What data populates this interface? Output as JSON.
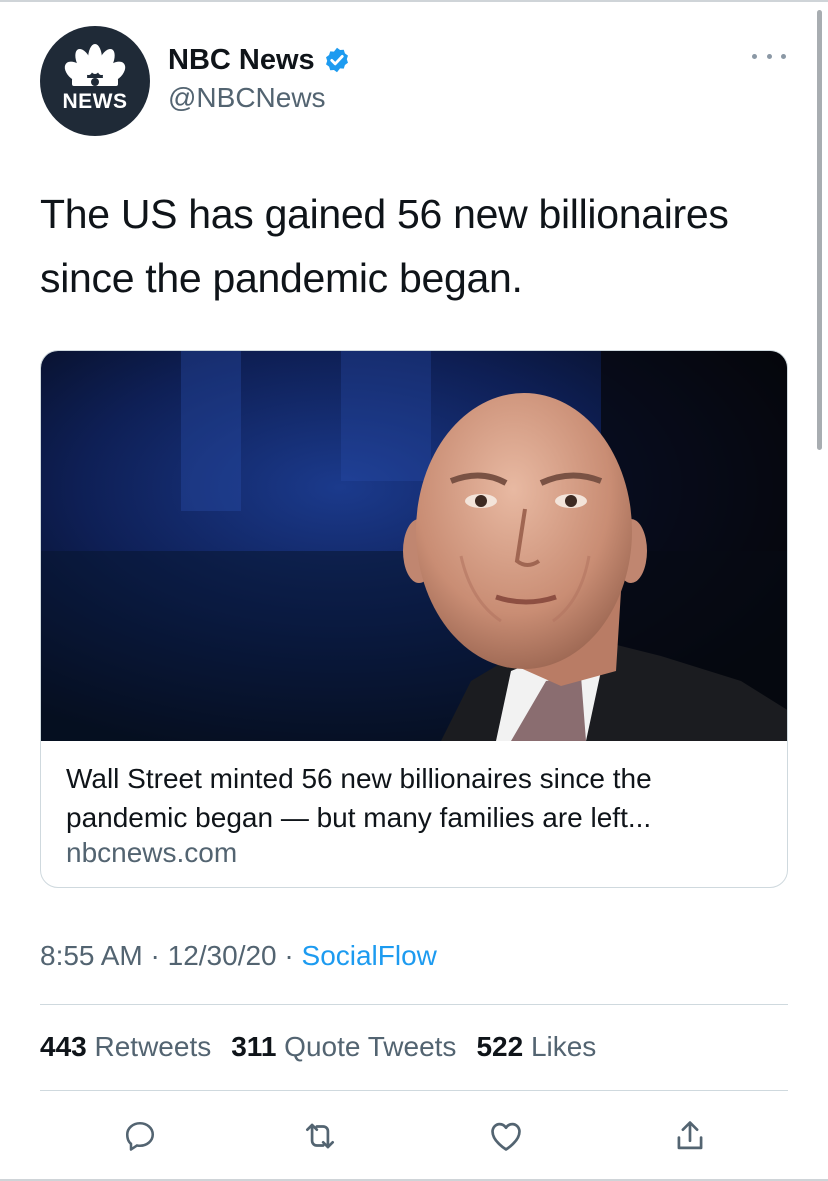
{
  "author": {
    "display_name": "NBC News",
    "handle": "@NBCNews",
    "avatar_text": "NEWS",
    "verified": true
  },
  "tweet": {
    "text": "The US has gained 56 new billionaires since the pandemic began."
  },
  "card": {
    "title": "Wall Street minted 56 new billionaires since the pandemic began — but many families are left...",
    "domain": "nbcnews.com"
  },
  "meta": {
    "time": "8:55 AM",
    "separator": "·",
    "date": "12/30/20",
    "source": "SocialFlow"
  },
  "stats": {
    "retweets_count": "443",
    "retweets_label": "Retweets",
    "quotes_count": "311",
    "quotes_label": "Quote Tweets",
    "likes_count": "522",
    "likes_label": "Likes"
  },
  "icons": {
    "reply": "reply-icon",
    "retweet": "retweet-icon",
    "like": "heart-icon",
    "share": "share-icon",
    "more": "more-icon",
    "verified": "verified-badge-icon"
  },
  "colors": {
    "accent": "#1d9bf0",
    "secondary_text": "#536471",
    "avatar_bg": "#1f2a37"
  }
}
